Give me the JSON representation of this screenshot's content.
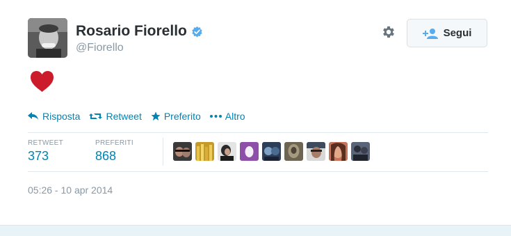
{
  "user": {
    "name": "Rosario Fiorello",
    "handle": "@Fiorello"
  },
  "header": {
    "follow_label": "Segui"
  },
  "tweet": {
    "content_icon": "heart-icon",
    "heart_color": "#cc1b2b"
  },
  "actions": [
    {
      "label": "Risposta",
      "icon": "reply-icon"
    },
    {
      "label": "Retweet",
      "icon": "retweet-icon"
    },
    {
      "label": "Preferito",
      "icon": "star-icon"
    },
    {
      "label": "Altro",
      "icon": "more-icon"
    }
  ],
  "stats": {
    "retweets": {
      "label": "RETWEET",
      "value": "373"
    },
    "favorites": {
      "label": "PREFERITI",
      "value": "868"
    }
  },
  "favorited_by_count_shown": 9,
  "timestamp": "05:26 - 10 apr 2014",
  "colors": {
    "accent": "#0084b4",
    "verified": "#55acee",
    "muted": "#8899a6"
  }
}
